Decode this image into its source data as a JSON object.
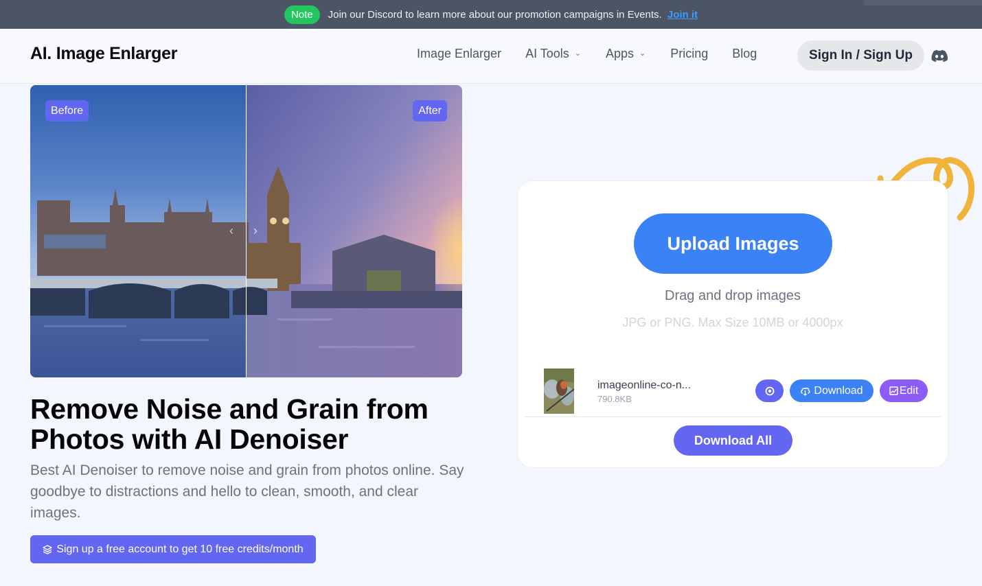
{
  "notice": {
    "badge": "Note",
    "text": "Join our Discord to learn more about our promotion campaigns in Events.",
    "link": "Join it"
  },
  "header": {
    "logo": "AI. Image Enlarger",
    "nav": [
      {
        "label": "Image Enlarger",
        "dropdown": false
      },
      {
        "label": "AI Tools",
        "dropdown": true
      },
      {
        "label": "Apps",
        "dropdown": true
      },
      {
        "label": "Pricing",
        "dropdown": false
      },
      {
        "label": "Blog",
        "dropdown": false
      }
    ],
    "signin": "Sign In / Sign Up",
    "discord_icon": "discord-icon",
    "dropdown_glyph": "⌄"
  },
  "compare": {
    "before_label": "Before",
    "after_label": "After",
    "handle_left": "‹",
    "handle_right": "›"
  },
  "hero": {
    "headline": "Remove Noise and Grain from Photos with AI Denoiser",
    "subtext": "Best AI Denoiser to remove noise and grain from photos online. Say goodbye to distractions and hello to clean, smooth, and clear images.",
    "cta": "Sign up a free account to get 10 free credits/month",
    "cta_icon": "layers-icon"
  },
  "upload": {
    "button": "Upload Images",
    "drag_text": "Drag and drop images",
    "hint": "JPG or PNG. Max Size 10MB or 4000px",
    "files": [
      {
        "name": "imageonline-co-n...",
        "size": "790.8KB",
        "actions": {
          "view_icon": "eye-icon",
          "download": "Download",
          "edit": "Edit"
        }
      }
    ],
    "download_all": "Download All"
  },
  "colors": {
    "accent": "#6366f1",
    "primary": "#3b82f6",
    "edit": "#8b5cf6",
    "note": "#22c55e",
    "arrow": "#f0b43c"
  }
}
